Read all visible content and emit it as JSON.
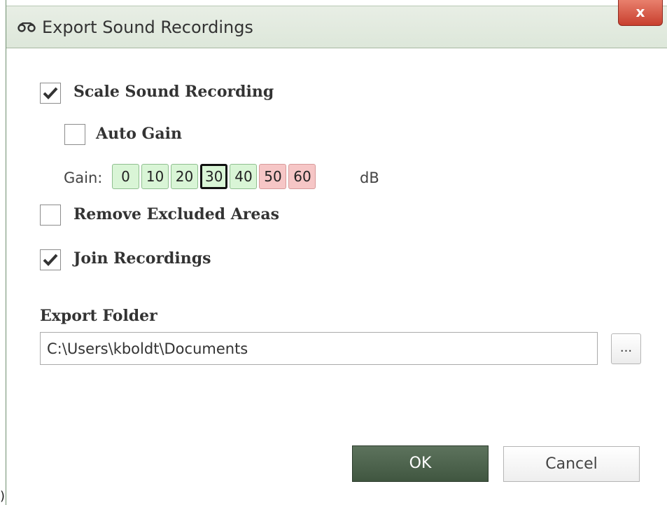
{
  "window": {
    "title": "Export Sound Recordings",
    "title_icon": "binoculars-icon",
    "close_label": "x"
  },
  "options": {
    "scale_sound_recording": {
      "label": "Scale Sound Recording",
      "checked": true
    },
    "auto_gain": {
      "label": "Auto Gain",
      "checked": false
    },
    "remove_excluded_areas": {
      "label": "Remove Excluded Areas",
      "checked": false
    },
    "join_recordings": {
      "label": "Join Recordings",
      "checked": true
    }
  },
  "gain": {
    "label": "Gain:",
    "unit": "dB",
    "selected": "30",
    "values": [
      "0",
      "10",
      "20",
      "30",
      "40",
      "50",
      "60"
    ],
    "colors": {
      "normal": "#d9f5d6",
      "high": "#f6c6c6"
    }
  },
  "export_folder": {
    "heading": "Export Folder",
    "value": "C:\\Users\\kboldt\\Documents",
    "browse_label": "..."
  },
  "buttons": {
    "ok": "OK",
    "cancel": "Cancel"
  },
  "colors": {
    "accent": "#405640",
    "title_bar": "#dde7da",
    "close": "#c83f2e"
  }
}
